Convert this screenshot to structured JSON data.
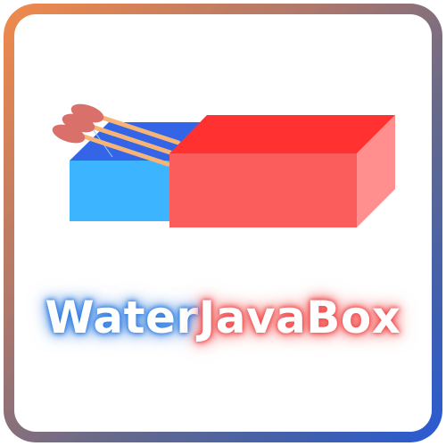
{
  "logo": {
    "word_water": "Water",
    "word_javabox": "JavaBox"
  },
  "colors": {
    "frame_gradient": [
      "#f08a4b",
      "#6a6a88",
      "#2a5bd6"
    ],
    "drawer_face": "#3db4ff",
    "drawer_top": "#3465e6",
    "sleeve_front": "#fb5c5c",
    "sleeve_top": "#ff3131",
    "sleeve_side": "#ff8f8f",
    "match_stick": "#f6b477",
    "match_head": "#d9706a",
    "glow_water": "#2f7de0",
    "glow_javabox": "#f24a4a"
  },
  "icons": [
    "matchbox-icon",
    "matchsticks-icon"
  ]
}
